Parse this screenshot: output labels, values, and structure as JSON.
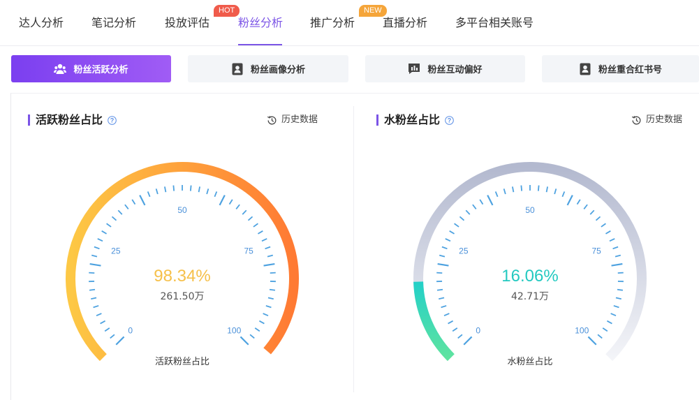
{
  "nav": {
    "tabs": [
      "达人分析",
      "笔记分析",
      "投放评估",
      "粉丝分析",
      "推广分析",
      "直播分析",
      "多平台相关账号"
    ],
    "active_index": 3,
    "badges": {
      "hot": "HOT",
      "new": "NEW"
    }
  },
  "subtabs": [
    "粉丝活跃分析",
    "粉丝画像分析",
    "粉丝互动偏好",
    "粉丝重合红书号"
  ],
  "cards": [
    {
      "title": "活跃粉丝占比",
      "history": "历史数据",
      "percent_text": "98.34%",
      "percent": 98.34,
      "count": "261.50万",
      "label": "活跃粉丝占比",
      "ticks": [
        "0",
        "25",
        "50",
        "75",
        "100"
      ],
      "percent_color": "#f6c04a",
      "arc_colors": [
        "#fdc845",
        "#ff7a33"
      ]
    },
    {
      "title": "水粉丝占比",
      "history": "历史数据",
      "percent_text": "16.06%",
      "percent": 16.06,
      "count": "42.71万",
      "label": "水粉丝占比",
      "ticks": [
        "0",
        "25",
        "50",
        "75",
        "100"
      ],
      "percent_color": "#23c9c0",
      "arc_colors": [
        "#23d0c8",
        "#5ee3a0"
      ],
      "track_colors": [
        "#b3b9cf",
        "#f3f4f8"
      ]
    }
  ],
  "colors": {
    "accent": "#7b54e6",
    "tick": "#4ea2e0"
  }
}
